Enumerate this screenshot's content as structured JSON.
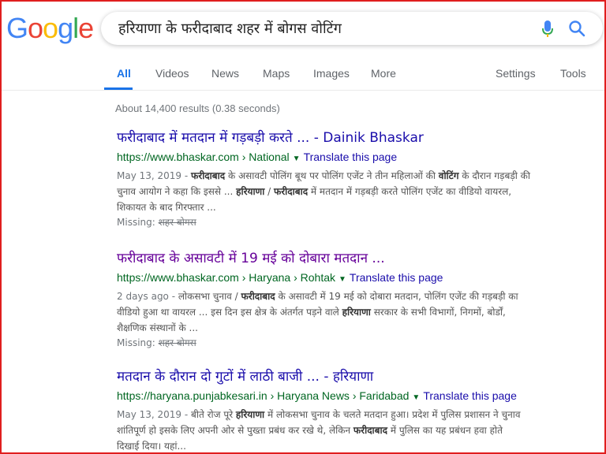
{
  "search": {
    "query": "हरियाणा के फरीदाबाद शहर में बोगस वोटिंग"
  },
  "logo": {
    "letters": [
      "G",
      "o",
      "o",
      "g",
      "l",
      "e"
    ],
    "colors": [
      "#4285F4",
      "#EA4335",
      "#FBBC05",
      "#4285F4",
      "#34A853",
      "#EA4335"
    ]
  },
  "tabs": {
    "all": "All",
    "videos": "Videos",
    "news": "News",
    "maps": "Maps",
    "images": "Images",
    "more": "More",
    "settings": "Settings",
    "tools": "Tools"
  },
  "stats": "About 14,400 results (0.38 seconds)",
  "results": [
    {
      "title": "फरीदाबाद में मतदान में गड़बड़ी करते ... - Dainik Bhaskar",
      "url": "https://www.bhaskar.com › National",
      "translate": "Translate this page",
      "snippet_lines": [
        {
          "date": "May 13, 2019 - ",
          "b1": "फरीदाबाद",
          "t1": " के असावटी पोलिंग बूथ पर पोलिंग एजेंट ने तीन महिलाओं की ",
          "b2": "वोटिंग",
          "t2": " के दौरान गड़बड़ी की"
        },
        {
          "t1": "चुनाव आयोग ने कहा कि इससे ... ",
          "b1": "हरियाणा",
          "t2": " / ",
          "b2": "फरीदाबाद",
          "t3": " में मतदान में गड़बड़ी करते पोलिंग एजेंट का वीडियो वायरल,"
        },
        {
          "t1": "शिकायत के बाद गिरफ्तार ..."
        }
      ],
      "missing_label": "Missing: ",
      "missing_terms": "शहर बोगस"
    },
    {
      "title": "फरीदाबाद के असावटी में 19 मई को दोबारा मतदान ...",
      "url": "https://www.bhaskar.com › Haryana › Rohtak",
      "translate": "Translate this page",
      "snippet_lines": [
        {
          "date": "2 days ago - ",
          "t1": "लोकसभा चुनाव / ",
          "b1": "फरीदाबाद",
          "t2": " के असावटी में 19 मई को दोबारा मतदान, पोलिंग एजेंट की गड़बड़ी का"
        },
        {
          "t1": "वीडियो हुआ था वायरल ... इस दिन इस क्षेत्र के अंतर्गत पड़ने वाले ",
          "b1": "हरियाणा",
          "t2": " सरकार के सभी विभागों, निगमों, बोर्डों,"
        },
        {
          "t1": "शैक्षणिक संस्थानों के ..."
        }
      ],
      "missing_label": "Missing: ",
      "missing_terms": "शहर बोगस"
    },
    {
      "title": "मतदान के दौरान दो गुटों में लाठी बाजी ... - हरियाणा",
      "url": "https://haryana.punjabkesari.in › Haryana News › Faridabad",
      "translate": "Translate this page",
      "snippet_lines": [
        {
          "date": "May 13, 2019 - ",
          "t1": "बीते रोज पूरे ",
          "b1": "हरियाणा",
          "t2": " में लोकसभा चुनाव के चलते मतदान हुआ। प्रदेश में पुलिस प्रशासन ने चुनाव"
        },
        {
          "t1": "शांतिपूर्ण हो इसके लिए अपनी ओर से पुख्ता प्रबंध कर रखे थे, लेकिन ",
          "b1": "फरीदाबाद",
          "t2": " में पुलिस का यह प्रबंधन हवा होते"
        },
        {
          "t1": "दिखाई दिया। यहां..."
        }
      ]
    }
  ]
}
